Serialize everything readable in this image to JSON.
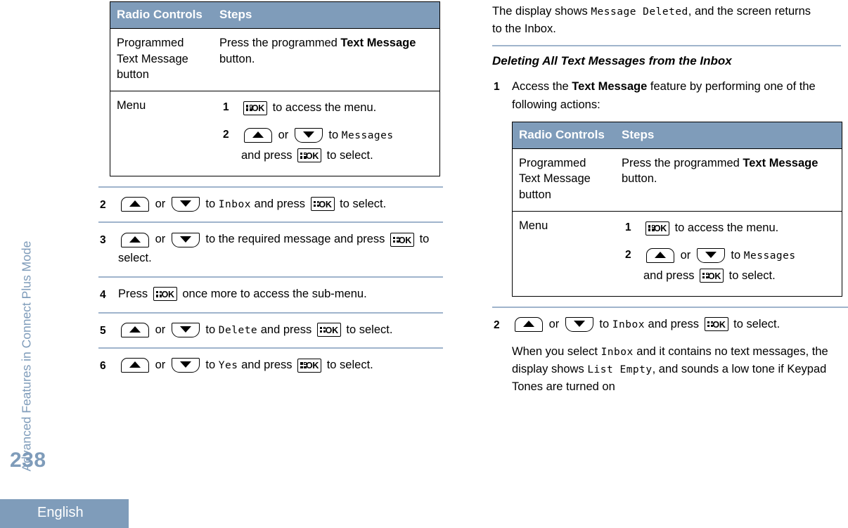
{
  "sidebar": {
    "chapter_label": "Advanced Features in Connect Plus Mode",
    "page_number": "238",
    "footer_language": "English",
    "accent_color": "#7f9cba"
  },
  "icons": {
    "ok_button": "menu-ok-button-icon",
    "ok_button_text": "OK",
    "up_button": "scroll-up-button-icon",
    "down_button": "scroll-down-button-icon"
  },
  "table": {
    "headers": {
      "col1": "Radio Controls",
      "col2": "Steps"
    },
    "row1": {
      "control": "Programmed Text Message button",
      "step_pre": "Press the programmed ",
      "step_bold": "Text Message",
      "step_post": " button."
    },
    "row2": {
      "control": "Menu",
      "substep1_num": "1",
      "substep1_text": " to access the menu.",
      "substep2_num": "2",
      "substep2_or": " or ",
      "substep2_to": " to ",
      "substep2_lcd": "Messages",
      "substep2_tail_pre": "and press ",
      "substep2_tail_post": " to select."
    }
  },
  "left_column": {
    "steps": [
      {
        "num": "2",
        "or": " or ",
        "to": " to ",
        "lcd": "Inbox",
        "mid": " and press ",
        "tail": " to select."
      },
      {
        "num": "3",
        "or": " or ",
        "to_text": " to the required message and press ",
        "tail": " to select."
      },
      {
        "num": "4",
        "pre": "Press ",
        "post": " once more to access the sub-menu."
      },
      {
        "num": "5",
        "or": " or ",
        "to": " to ",
        "lcd": "Delete",
        "mid": " and press ",
        "tail": " to select."
      },
      {
        "num": "6",
        "or": " or ",
        "to": " to ",
        "lcd": "Yes",
        "mid": " and press ",
        "tail": " to select."
      }
    ]
  },
  "right_column": {
    "intro_pre": "The display shows ",
    "intro_lcd": "Message Deleted",
    "intro_post": ", and the screen returns to the Inbox.",
    "heading": "Deleting All Text Messages from the Inbox",
    "step1": {
      "num": "1",
      "pre": "Access the ",
      "bold": "Text Message",
      "post": " feature by performing one of the following actions:"
    },
    "step2": {
      "num": "2",
      "or": " or ",
      "to": " to ",
      "lcd": "Inbox",
      "mid": " and press ",
      "tail": " to select."
    },
    "note": {
      "pre": "When you select ",
      "lcd1": "Inbox",
      "mid": " and it contains no text messages, the display shows ",
      "lcd2": "List Empty",
      "post": ", and sounds a low tone if Keypad Tones are turned on"
    }
  }
}
